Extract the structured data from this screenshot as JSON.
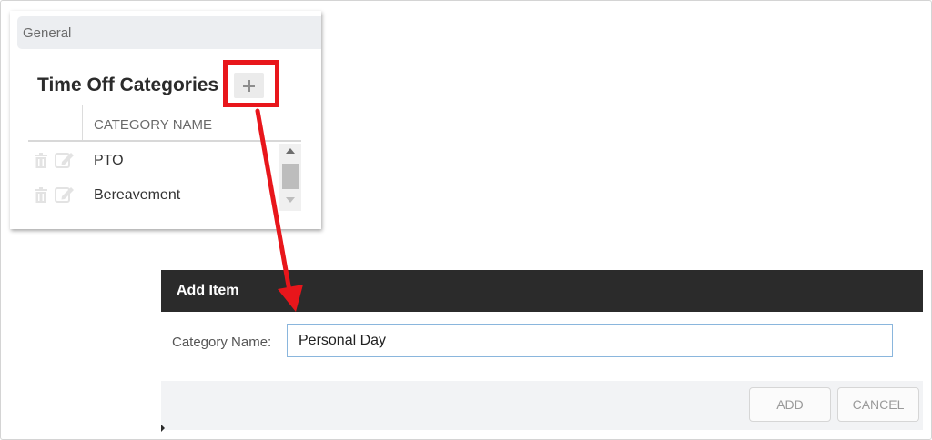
{
  "panel": {
    "header_label": "General",
    "section_title": "Time Off Categories",
    "add_icon": "plus-icon",
    "table": {
      "column_header": "CATEGORY NAME",
      "rows": [
        {
          "name": "PTO",
          "icons": [
            "trash-icon",
            "edit-icon"
          ]
        },
        {
          "name": "Bereavement",
          "icons": [
            "trash-icon",
            "edit-icon"
          ]
        }
      ]
    }
  },
  "dialog": {
    "title": "Add Item",
    "field_label": "Category Name:",
    "field_value": "Personal Day",
    "add_label": "ADD",
    "cancel_label": "CANCEL"
  },
  "annotation": {
    "highlight_color": "#e8161b",
    "arrow_color": "#e8161b"
  }
}
